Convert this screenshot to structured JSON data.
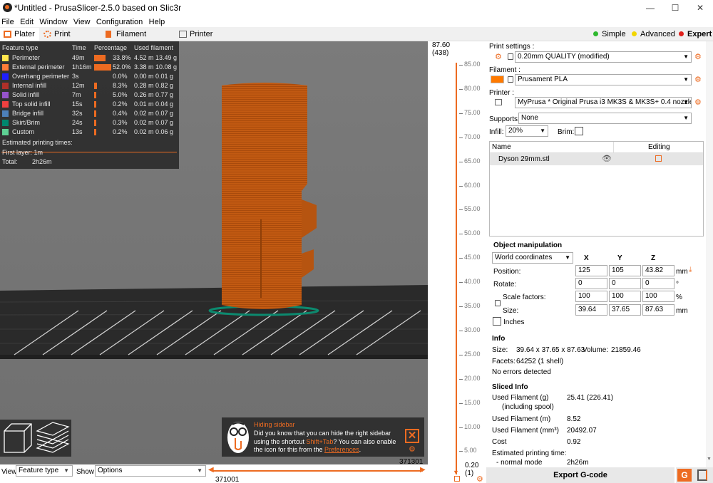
{
  "window": {
    "title": "*Untitled - PrusaSlicer-2.5.0 based on Slic3r",
    "minimize": "—",
    "maximize": "☐",
    "close": "✕"
  },
  "menu": [
    "File",
    "Edit",
    "Window",
    "View",
    "Configuration",
    "Help"
  ],
  "tabs": [
    {
      "label": "Plater",
      "active": true
    },
    {
      "label": "Print Settings"
    },
    {
      "label": "Filament Settings"
    },
    {
      "label": "Printer Settings"
    }
  ],
  "modes": [
    {
      "label": "Simple",
      "color": "#2eb82e"
    },
    {
      "label": "Advanced",
      "color": "#f2d600"
    },
    {
      "label": "Expert",
      "color": "#e0201b",
      "active": true
    }
  ],
  "legend": {
    "headers": [
      "Feature type",
      "Time",
      "Percentage",
      "Used filament"
    ],
    "rows": [
      {
        "name": "Perimeter",
        "color": "#ffe64d",
        "time": "49m",
        "pct": "33.8%",
        "frac": 0.338,
        "len": "4.52 m",
        "wt": "13.49 g"
      },
      {
        "name": "External perimeter",
        "color": "#ff7d38",
        "time": "1h16m",
        "pct": "52.0%",
        "frac": 0.52,
        "len": "3.38 m",
        "wt": "10.08 g"
      },
      {
        "name": "Overhang perimeter",
        "color": "#1f1fff",
        "time": "3s",
        "pct": "0.0%",
        "frac": 0.0,
        "len": "0.00 m",
        "wt": "0.01 g"
      },
      {
        "name": "Internal infill",
        "color": "#b03029",
        "time": "12m",
        "pct": "8.3%",
        "frac": 0.083,
        "len": "0.28 m",
        "wt": "0.82 g"
      },
      {
        "name": "Solid infill",
        "color": "#9654cc",
        "time": "7m",
        "pct": "5.0%",
        "frac": 0.05,
        "len": "0.26 m",
        "wt": "0.77 g"
      },
      {
        "name": "Top solid infill",
        "color": "#f04040",
        "time": "15s",
        "pct": "0.2%",
        "frac": 0.002,
        "len": "0.01 m",
        "wt": "0.04 g"
      },
      {
        "name": "Bridge infill",
        "color": "#4d80ba",
        "time": "32s",
        "pct": "0.4%",
        "frac": 0.004,
        "len": "0.02 m",
        "wt": "0.07 g"
      },
      {
        "name": "Skirt/Brim",
        "color": "#00876e",
        "time": "24s",
        "pct": "0.3%",
        "frac": 0.003,
        "len": "0.02 m",
        "wt": "0.07 g"
      },
      {
        "name": "Custom",
        "color": "#5ed194",
        "time": "13s",
        "pct": "0.2%",
        "frac": 0.002,
        "len": "0.02 m",
        "wt": "0.06 g"
      }
    ],
    "estimated_label": "Estimated printing times:",
    "first_layer_label": "First layer:",
    "first_layer_value": "1m",
    "total_label": "Total:",
    "total_value": "2h26m"
  },
  "tip": {
    "title": "Hiding sidebar",
    "line1": "Did you know that you can hide the right sidebar",
    "line2_pre": "using the shortcut ",
    "shortcut": "Shift+Tab",
    "line2_post": "? You can also enable",
    "line3_pre": "the icon for this from the ",
    "link": "Preferences",
    "line3_post": "."
  },
  "bottom": {
    "view_label": "View",
    "view_value": "Feature type",
    "show_label": "Show",
    "show_value": "Options",
    "hslider_right": "371301",
    "hslider_left": "371001"
  },
  "vslider": {
    "top_value": "87.60",
    "top_layer": "(438)",
    "bottom_value": "0.20",
    "bottom_layer": "(1)",
    "ticks": [
      "85.00",
      "80.00",
      "75.00",
      "70.00",
      "65.00",
      "60.00",
      "55.00",
      "50.00",
      "45.00",
      "40.00",
      "35.00",
      "30.00",
      "25.00",
      "20.00",
      "15.00",
      "10.00",
      "5.00"
    ]
  },
  "sidebar": {
    "print_settings_label": "Print settings :",
    "print_settings_value": "0.20mm QUALITY (modified)",
    "filament_label": "Filament :",
    "filament_value": "Prusament PLA",
    "filament_color": "#ff7a00",
    "printer_label": "Printer :",
    "printer_value": "MyPrusa * Original Prusa i3 MK3S & MK3S+ 0.4 nozzle- le",
    "supports_label": "Supports:",
    "supports_value": "None",
    "infill_label": "Infill:",
    "infill_value": "20%",
    "brim_label": "Brim:",
    "list_headers": {
      "name": "Name",
      "editing": "Editing"
    },
    "object_name": "Dyson 29mm.stl"
  },
  "manip": {
    "title": "Object manipulation",
    "coords": "World coordinates",
    "axes": [
      "X",
      "Y",
      "Z"
    ],
    "position_label": "Position:",
    "position": [
      "125",
      "105",
      "43.82"
    ],
    "position_unit": "mm",
    "rotate_label": "Rotate:",
    "rotate": [
      "0",
      "0",
      "0"
    ],
    "rotate_unit": "°",
    "scale_label": "Scale factors:",
    "scale": [
      "100",
      "100",
      "100"
    ],
    "scale_unit": "%",
    "size_label": "Size:",
    "size": [
      "39.64",
      "37.65",
      "87.63"
    ],
    "size_unit": "mm",
    "inches_label": "Inches"
  },
  "info": {
    "title": "Info",
    "size_label": "Size:",
    "size_value": "39.64 x 37.65 x 87.63",
    "volume_label": "Volume:",
    "volume_value": "21859.46",
    "facets_label": "Facets:",
    "facets_value": "64252 (1 shell)",
    "errors": "No errors detected"
  },
  "sliced": {
    "title": "Sliced Info",
    "used_g_label": "Used Filament (g)",
    "used_g_value": "25.41 (226.41)",
    "spool_label": "(including spool)",
    "used_m_label": "Used Filament (m)",
    "used_m_value": "8.52",
    "used_mm3_label": "Used Filament (mm³)",
    "used_mm3_value": "20492.07",
    "cost_label": "Cost",
    "cost_value": "0.92",
    "est_label": "Estimated printing time:",
    "normal_label": "- normal mode",
    "normal_value": "2h26m"
  },
  "export_label": "Export G-code"
}
